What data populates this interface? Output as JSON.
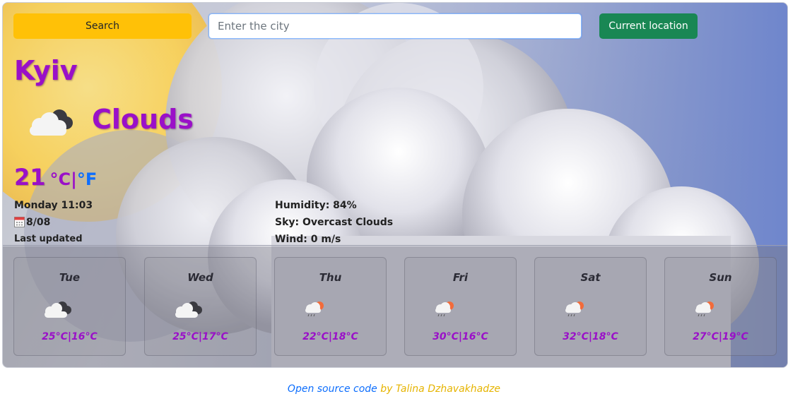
{
  "search": {
    "button_label": "Search",
    "placeholder": "Enter the city",
    "current_location_label": "Current location"
  },
  "weather": {
    "city": "Kyiv",
    "description": "Clouds",
    "temperature": "21",
    "unit_celsius": "°C",
    "unit_separator": "|",
    "unit_fahrenheit": "°F",
    "icon": "cloudy-icon",
    "datetime": "Monday 11:03",
    "date": "8/08",
    "last_updated": "Last updated",
    "humidity": "Humidity: 84%",
    "sky": "Sky: Overcast Clouds",
    "wind": "Wind: 0 m/s"
  },
  "forecast": [
    {
      "day": "Tue",
      "temps": "25°C|16°C",
      "icon": "cloudy-icon"
    },
    {
      "day": "Wed",
      "temps": "25°C|17°C",
      "icon": "cloudy-icon"
    },
    {
      "day": "Thu",
      "temps": "22°C|18°C",
      "icon": "sun-rain-icon"
    },
    {
      "day": "Fri",
      "temps": "30°C|16°C",
      "icon": "sun-rain-icon"
    },
    {
      "day": "Sat",
      "temps": "32°C|18°C",
      "icon": "sun-rain-icon"
    },
    {
      "day": "Sun",
      "temps": "27°C|19°C",
      "icon": "sun-rain-icon"
    }
  ],
  "footer": {
    "link_text": "Open source code",
    "author_text": " by Talina Dzhavakhadze"
  },
  "colors": {
    "accent_purple": "#9a10c8",
    "search_yellow": "#ffc107",
    "location_green": "#198754",
    "link_blue": "#0d6efd"
  }
}
